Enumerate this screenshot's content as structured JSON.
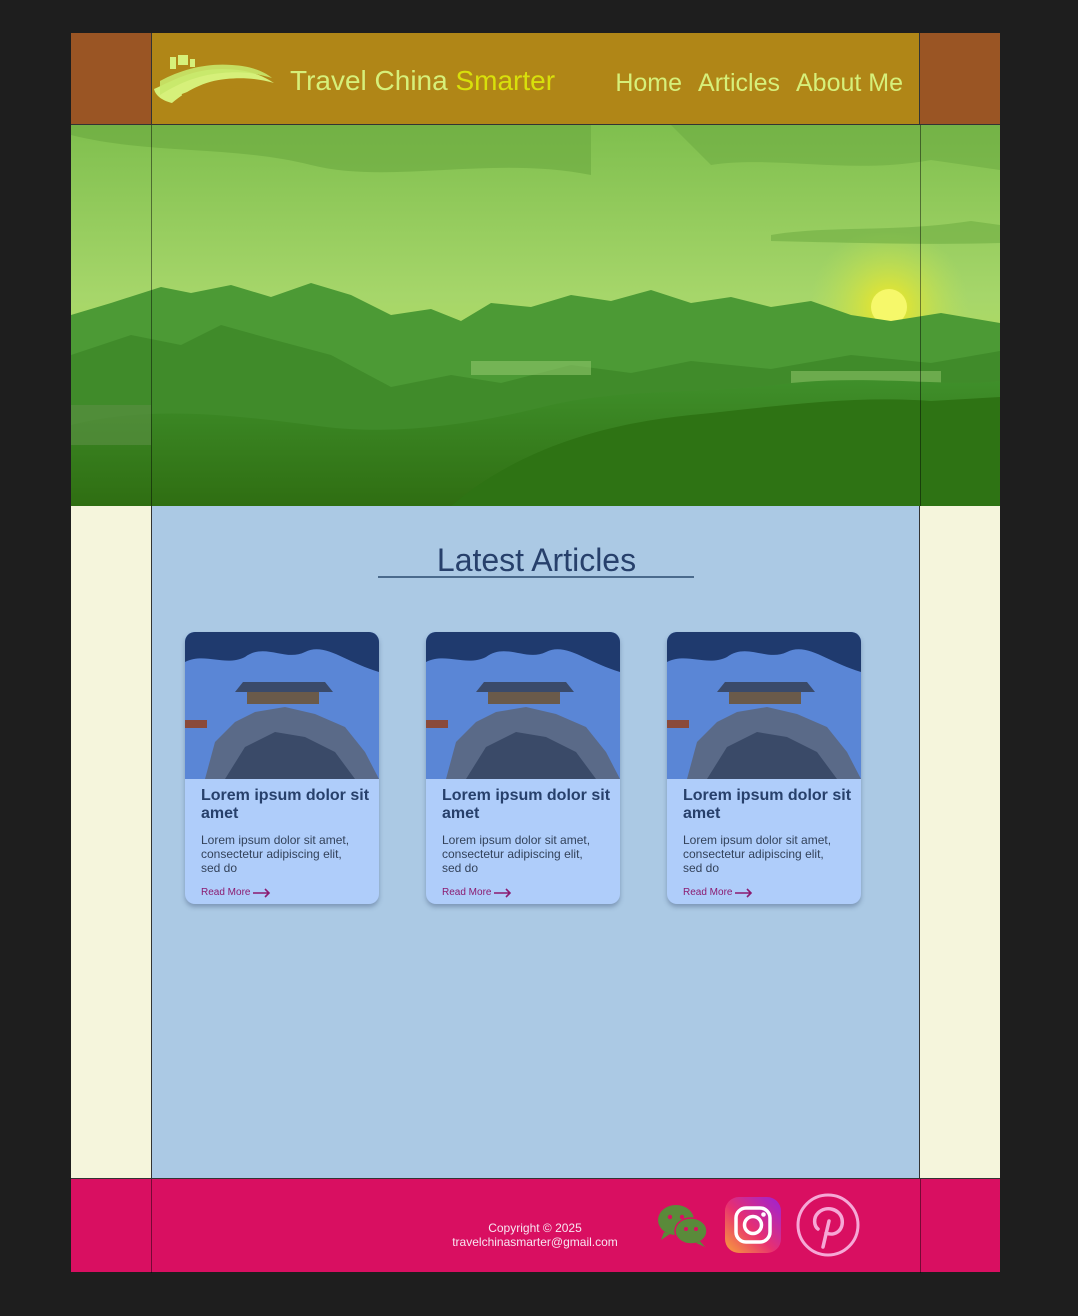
{
  "header": {
    "site_title_main": "Travel China ",
    "site_title_accent": "Smarter",
    "nav": [
      "Home",
      "Articles",
      "About Me"
    ]
  },
  "main": {
    "section_title": "Latest Articles",
    "cards": [
      {
        "title": "Lorem ipsum dolor sit amet",
        "excerpt": "Lorem ipsum dolor sit amet, consectetur adipiscing elit, sed do",
        "link": "Read More"
      },
      {
        "title": "Lorem ipsum dolor sit amet",
        "excerpt": "Lorem ipsum dolor sit amet, consectetur adipiscing elit, sed do",
        "link": "Read More"
      },
      {
        "title": "Lorem ipsum dolor sit amet",
        "excerpt": "Lorem ipsum dolor sit amet, consectetur adipiscing elit, sed do",
        "link": "Read More"
      }
    ]
  },
  "footer": {
    "copyright": "Copyright © 2025",
    "email": "travelchinasmarter@gmail.com",
    "social_icons": [
      "wechat-icon",
      "instagram-icon",
      "pinterest-icon"
    ]
  },
  "colors": {
    "header_bg": "#b08617",
    "header_side": "#9a5524",
    "title_text": "#d6f07a",
    "title_accent": "#d8e00b",
    "main_bg": "#abc9e4",
    "side_bg": "#f5f5dc",
    "card_bg": "#afcdfa",
    "heading_text": "#27406b",
    "link_text": "#8b1b70",
    "footer_bg": "#d90f61"
  }
}
